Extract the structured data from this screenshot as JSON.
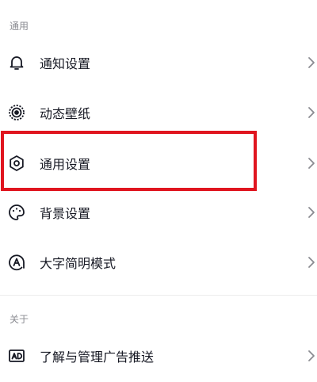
{
  "sections": {
    "general_label": "通用",
    "about_label": "关于"
  },
  "items": {
    "notify": {
      "label": "通知设置",
      "icon": "bell-icon"
    },
    "wallpaper": {
      "label": "动态壁纸",
      "icon": "live-wallpaper-icon"
    },
    "general": {
      "label": "通用设置",
      "icon": "gear-icon"
    },
    "background": {
      "label": "背景设置",
      "icon": "palette-icon"
    },
    "bigtext": {
      "label": "大字简明模式",
      "icon": "large-text-icon"
    },
    "ads": {
      "label": "了解与管理广告推送",
      "icon": "ad-icon"
    }
  },
  "colors": {
    "highlight": "#e0151f",
    "text": "#161823",
    "secondary": "#8a8b91"
  }
}
